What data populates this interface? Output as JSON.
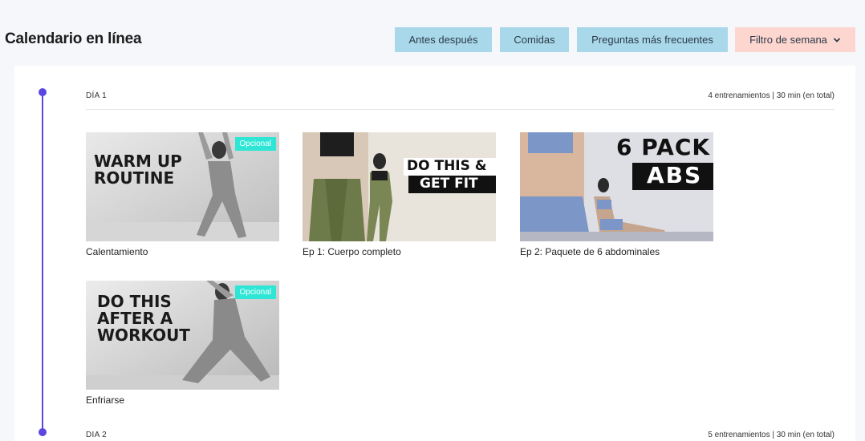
{
  "header": {
    "title": "Calendario en línea",
    "nav": {
      "before_after": "Antes después",
      "meals": "Comidas",
      "faq": "Preguntas más frecuentes",
      "week_filter": "Filtro de semana"
    }
  },
  "colors": {
    "accent": "#5b47e0",
    "nav_blue": "#a8d8ea",
    "nav_pink": "#fdd6d0",
    "badge": "#2ee6d6"
  },
  "days": [
    {
      "label": "DÍA 1",
      "summary": "4 entrenamientos | 30 min (en total)",
      "workouts": [
        {
          "caption": "Calentamiento",
          "badge": "Opcional",
          "thumb_lines": [
            "WARM UP",
            "ROUTINE"
          ]
        },
        {
          "caption": "Ep 1: Cuerpo completo",
          "badge": "",
          "thumb_lines": [
            "DO THIS &",
            "GET FIT"
          ]
        },
        {
          "caption": "Ep 2: Paquete de 6 abdominales",
          "badge": "",
          "thumb_lines": [
            "6 PACK",
            "ABS"
          ]
        },
        {
          "caption": "Enfriarse",
          "badge": "Opcional",
          "thumb_lines": [
            "DO THIS",
            "AFTER A",
            "WORKOUT"
          ]
        }
      ]
    },
    {
      "label": "DIA 2",
      "summary": "5 entrenamientos | 30 min (en total)"
    }
  ]
}
